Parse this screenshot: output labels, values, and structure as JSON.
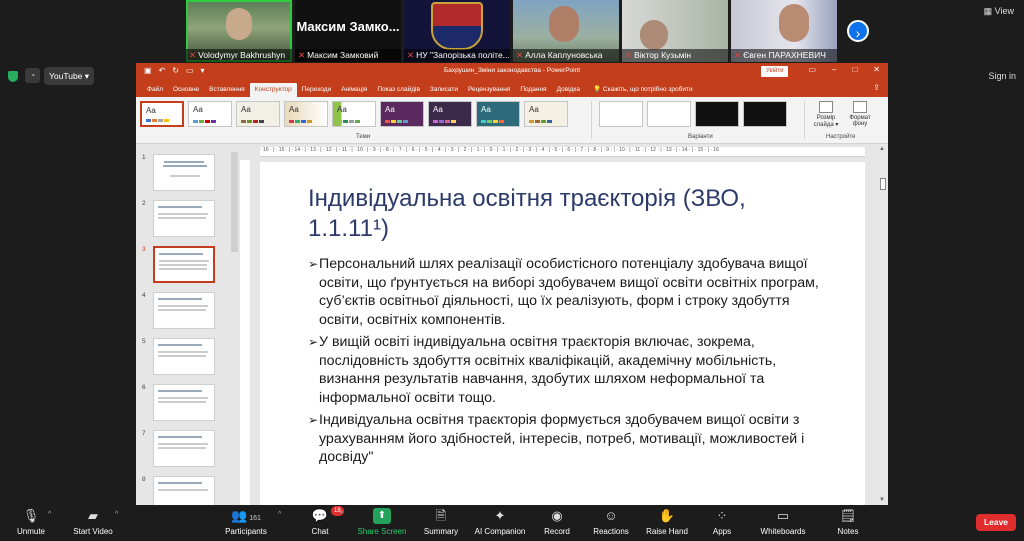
{
  "participants_strip": [
    {
      "name": "Volodymyr Bakhrushyn",
      "muted": true,
      "active": true
    },
    {
      "name": "Максим Замковий",
      "muted": true,
      "active": false,
      "display_name": "Максим Замко..."
    },
    {
      "name": "НУ \"Запорізька політе...",
      "muted": true,
      "active": false
    },
    {
      "name": "Алла Каплуновська",
      "muted": true,
      "active": false
    },
    {
      "name": "Віктор Кузьмін",
      "muted": true,
      "active": false
    },
    {
      "name": "Євген ПАРАХНЕВИЧ",
      "muted": true,
      "active": false
    }
  ],
  "view_label": "View",
  "browser": {
    "feed_icon": "rss-icon",
    "tab_label": "YouTube ▾",
    "sign_in": "Sign in"
  },
  "ppt": {
    "doc_title": "Бахрушин_Зміни законодавства  -  PowerPoint",
    "sign_in": "Увійти",
    "tabs": [
      "Файл",
      "Основне",
      "Вставлення",
      "Конструктор",
      "Переходи",
      "Анімація",
      "Показ слайдів",
      "Записати",
      "Рецензування",
      "Подання",
      "Довідка"
    ],
    "active_tab": "Конструктор",
    "tell_me": "Скажіть, що потрібно зробити",
    "theme_sample": "Aa",
    "groups": {
      "themes": "Теми",
      "variants": "Варіанти",
      "customize": "Настройте"
    },
    "customize_buttons": [
      "Розмір слайда ▾",
      "Формат фону"
    ],
    "slide_numbers": [
      "1",
      "2",
      "3",
      "4",
      "5",
      "6",
      "7",
      "8"
    ],
    "slide": {
      "title": "Індивідуальна освітня траєкторія (ЗВО, 1.1.11¹)",
      "bullets": [
        "Персональний шлях реалізації особистісного потенціалу здобувача вищої освіти, що ґрунтується на виборі здобувачем вищої освіти освітніх програм, суб’єктів освітньої діяльності, що їх реалізують, форм і строку здобуття освіти, освітніх компонентів.",
        "У вищій освіті індивідуальна освітня траєкторія включає, зокрема, послідовність здобуття освітніх кваліфікацій, академічну мобільність, визнання результатів навчання, здобутих шляхом неформальної та інформальної освіти тощо.",
        "Індивідуальна освітня траєкторія формується здобувачем вищої освіти з урахуванням його здібностей, інтересів, потреб, мотивації, можливостей і досвіду\""
      ]
    },
    "ruler_marks": "· 16 · | · 15 · | · 14 · | · 13 · | · 12 · | · 11 · | · 10 · | · 9 · | · 8 · | · 7 · | · 6 · | · 5 · | · 4 · | · 3 · | · 2 · | · 1 · | · 0 · | · 1 · | · 2 · | · 3 · | · 4 · | · 5 · | · 6 · | · 7 · | · 8 · | · 9 · | · 10 · | · 11 · | · 12 · | · 13 · | · 14 · | · 15 · | · 16"
  },
  "toolbar": {
    "unmute": "Unmute",
    "start_video": "Start Video",
    "participants": "Participants",
    "participants_count": "161",
    "chat": "Chat",
    "chat_badge": "18",
    "share_screen": "Share Screen",
    "summary": "Summary",
    "ai_companion": "AI Companion",
    "record": "Record",
    "reactions": "Reactions",
    "raise_hand": "Raise Hand",
    "apps": "Apps",
    "whiteboards": "Whiteboards",
    "notes": "Notes",
    "leave": "Leave"
  },
  "colors": {
    "ppt_red": "#c43e1c",
    "title_blue": "#2b3a69",
    "zoom_green": "#23a25b",
    "leave_red": "#e02d2d"
  }
}
